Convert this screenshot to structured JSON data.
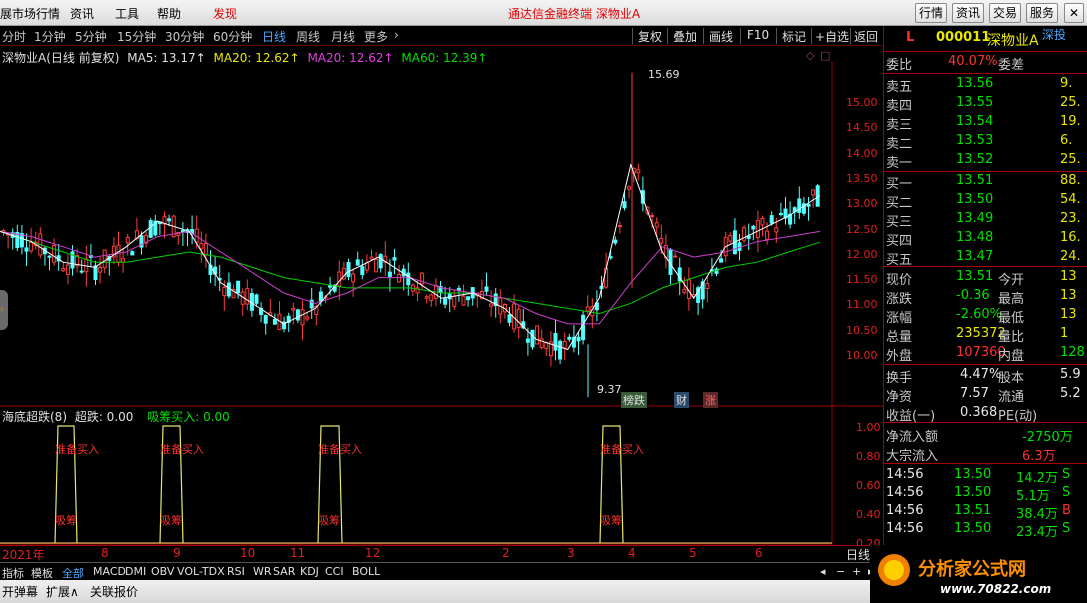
{
  "menu": {
    "items": [
      "展市场行情",
      "资讯",
      "工具",
      "帮助",
      "发现"
    ],
    "center_title": "通达信金融终端   深物业A"
  },
  "right_buttons": [
    "行情",
    "资讯",
    "交易",
    "服务"
  ],
  "periods": [
    "分时",
    "1分钟",
    "5分钟",
    "15分钟",
    "30分钟",
    "60分钟",
    "日线",
    "周线",
    "月线",
    "更多"
  ],
  "active_period": "日线",
  "toolbar": [
    "复权",
    "叠加",
    "画线",
    "F10",
    "标记",
    "+自选",
    "返回"
  ],
  "legend": {
    "title": "深物业A(日线 前复权)",
    "ma5": "MA5: 13.17↑",
    "ma20a": "MA20: 12.62↑",
    "ma20b": "MA20: 12.62↑",
    "ma60": "MA60: 12.39↑"
  },
  "indicator_legend": {
    "name": "海底超跌(8)",
    "a": "超跌: 0.00",
    "b": "吸筹买入: 0.00"
  },
  "price_axis": [
    "15.00",
    "14.50",
    "14.00",
    "13.50",
    "13.00",
    "12.50",
    "12.00",
    "11.50",
    "11.00",
    "10.50",
    "10.00"
  ],
  "ind_axis": [
    "1.00",
    "0.80",
    "0.60",
    "0.40",
    "0.20"
  ],
  "annotations": {
    "high": "15.69",
    "low": "9.37",
    "t1": "榜跌",
    "t2": "财",
    "t3": "涨"
  },
  "signal_labels": {
    "buy": "准备买入",
    "absorb": "吸筹"
  },
  "time_axis": [
    "2021年",
    "8",
    "9",
    "10",
    "11",
    "12",
    "2",
    "3",
    "4",
    "5",
    "6"
  ],
  "time_axis_btn": "日线",
  "stock": {
    "code": "000011",
    "name": "深物业A",
    "market": "深投",
    "tag": "L"
  },
  "weibi": {
    "label": "委比",
    "value": "40.07%",
    "label2": "委差"
  },
  "sells": [
    {
      "label": "卖五",
      "price": "13.56",
      "vol": "9."
    },
    {
      "label": "卖四",
      "price": "13.55",
      "vol": "25."
    },
    {
      "label": "卖三",
      "price": "13.54",
      "vol": "19."
    },
    {
      "label": "卖二",
      "price": "13.53",
      "vol": "6."
    },
    {
      "label": "卖一",
      "price": "13.52",
      "vol": "25."
    }
  ],
  "buys": [
    {
      "label": "买一",
      "price": "13.51",
      "vol": "88."
    },
    {
      "label": "买二",
      "price": "13.50",
      "vol": "54."
    },
    {
      "label": "买三",
      "price": "13.49",
      "vol": "23."
    },
    {
      "label": "买四",
      "price": "13.48",
      "vol": "16."
    },
    {
      "label": "买五",
      "price": "13.47",
      "vol": "24."
    }
  ],
  "quote": [
    {
      "l": "现价",
      "v": "13.51",
      "l2": "今开",
      "v2": "13"
    },
    {
      "l": "涨跌",
      "v": "-0.36",
      "l2": "最高",
      "v2": "13"
    },
    {
      "l": "涨幅",
      "v": "-2.60%",
      "l2": "最低",
      "v2": "13"
    },
    {
      "l": "总量",
      "v": "235372",
      "l2": "量比",
      "v2": "1"
    },
    {
      "l": "外盘",
      "v": "107360",
      "l2": "内盘",
      "v2": "128"
    }
  ],
  "fund": [
    {
      "l": "换手",
      "v": "4.47%",
      "l2": "股本",
      "v2": "5.9"
    },
    {
      "l": "净资",
      "v": "7.57",
      "l2": "流通",
      "v2": "5.2"
    },
    {
      "l": "收益(一)",
      "v": "0.368",
      "l2": "PE(动)",
      "v2": ""
    }
  ],
  "flow": [
    {
      "l": "净流入额",
      "v": "-2750万"
    },
    {
      "l": "大宗流入",
      "v": "6.3万"
    }
  ],
  "ticks": [
    {
      "t": "14:56",
      "p": "13.50",
      "v": "14.2万",
      "s": "S"
    },
    {
      "t": "14:56",
      "p": "13.50",
      "v": "5.1万",
      "s": "S"
    },
    {
      "t": "14:56",
      "p": "13.51",
      "v": "38.4万",
      "s": "B"
    },
    {
      "t": "14:56",
      "p": "13.50",
      "v": "23.4万",
      "s": "S"
    }
  ],
  "tabs": [
    "指标",
    "模板",
    "全部",
    "MACD",
    "DMI",
    "OBV",
    "VOL-TDX",
    "RSI",
    "WR",
    "SAR",
    "KDJ",
    "CCI",
    "BOLL"
  ],
  "active_tab": "全部",
  "status": [
    "开弹幕",
    "扩展∧",
    "关联报价"
  ],
  "watermark": {
    "title": "分析家公式网",
    "url": "www.70822.com"
  },
  "chart_data": {
    "type": "line",
    "series": [
      {
        "name": "MA5",
        "values": [
          12.6,
          12.4,
          12.0,
          11.9,
          12.3,
          12.8,
          12.6,
          11.6,
          11.2,
          10.8,
          11.1,
          11.8,
          12.1,
          11.7,
          11.3,
          11.4,
          11.1,
          10.5,
          10.3,
          11.3,
          13.9,
          12.2,
          11.3,
          12.3,
          12.6,
          12.9,
          13.3
        ]
      },
      {
        "name": "MA20",
        "values": [
          12.6,
          12.5,
          12.3,
          12.1,
          12.2,
          12.5,
          12.6,
          12.2,
          11.8,
          11.4,
          11.2,
          11.4,
          11.7,
          11.7,
          11.5,
          11.4,
          11.3,
          11.0,
          10.8,
          10.8,
          11.6,
          12.3,
          12.1,
          12.2,
          12.4,
          12.5,
          12.6
        ]
      },
      {
        "name": "MA60",
        "values": [
          12.6,
          12.4,
          12.2,
          12.0,
          12.0,
          12.1,
          12.2,
          12.1,
          11.9,
          11.7,
          11.6,
          11.5,
          11.5,
          11.5,
          11.4,
          11.4,
          11.3,
          11.2,
          11.1,
          11.0,
          11.2,
          11.5,
          11.7,
          11.9,
          12.0,
          12.2,
          12.39
        ]
      }
    ],
    "ylim": [
      9.2,
      15.9
    ],
    "high": 15.69,
    "low": 9.37
  }
}
